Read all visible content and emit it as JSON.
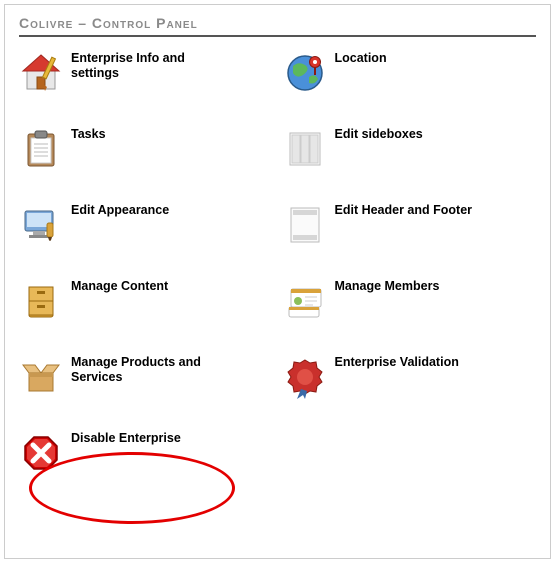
{
  "title": "Colivre – Control Panel",
  "items": {
    "info": "Enterprise Info and settings",
    "location": "Location",
    "tasks": "Tasks",
    "sideboxes": "Edit sideboxes",
    "appearance": "Edit Appearance",
    "header_footer": "Edit Header and Footer",
    "content": "Manage Content",
    "members": "Manage Members",
    "products": "Manage Products and Services",
    "validation": "Enterprise Validation",
    "disable": "Disable Enterprise"
  }
}
